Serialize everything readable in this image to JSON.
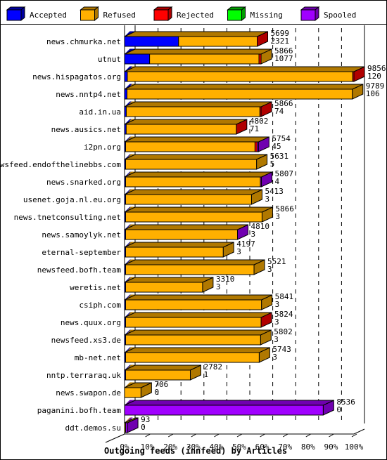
{
  "chart_data": {
    "type": "bar",
    "orientation": "horizontal",
    "stacked": true,
    "style": "3d",
    "title": "Outgoing feeds (innfeed) by Articles",
    "xlabel": "",
    "ylabel": "",
    "xlim": [
      0,
      100
    ],
    "x_unit": "% of max total",
    "max_total": 9856,
    "x_ticks": [
      "0%",
      "10%",
      "20%",
      "30%",
      "40%",
      "50%",
      "60%",
      "70%",
      "80%",
      "90%",
      "100%"
    ],
    "grid": "vertical dashed",
    "legend_position": "top",
    "legend": [
      {
        "name": "Accepted",
        "color": "#0000ff",
        "side": "#0000a0"
      },
      {
        "name": "Refused",
        "color": "#ffb000",
        "side": "#b07800"
      },
      {
        "name": "Rejected",
        "color": "#ff0000",
        "side": "#b00000"
      },
      {
        "name": "Missing",
        "color": "#00ff00",
        "side": "#00a000"
      },
      {
        "name": "Spooled",
        "color": "#a000ff",
        "side": "#7000b0"
      }
    ],
    "categories": [
      "news.chmurka.net",
      "utnut",
      "news.hispagatos.org",
      "news.nntp4.net",
      "aid.in.ua",
      "news.ausics.net",
      "i2pn.org",
      "newsfeed.endofthelinebbs.com",
      "news.snarked.org",
      "usenet.goja.nl.eu.org",
      "news.tnetconsulting.net",
      "news.samoylyk.net",
      "eternal-september",
      "newsfeed.bofh.team",
      "weretis.net",
      "csiph.com",
      "news.quux.org",
      "newsfeed.xs3.de",
      "mb-net.net",
      "nntp.terraraq.uk",
      "news.swapon.de",
      "paganini.bofh.team",
      "ddt.demos.su"
    ],
    "totals": [
      5699,
      5866,
      9856,
      9789,
      5866,
      4802,
      5754,
      5631,
      5807,
      5413,
      5866,
      4810,
      4197,
      5521,
      3310,
      5841,
      5824,
      5802,
      5743,
      2782,
      706,
      8536,
      93
    ],
    "accepted": [
      2321,
      1077,
      120,
      106,
      74,
      71,
      45,
      5,
      4,
      3,
      3,
      3,
      3,
      3,
      3,
      3,
      3,
      3,
      3,
      1,
      0,
      0,
      0
    ],
    "series": [
      {
        "name": "Accepted",
        "values": [
          2321,
          1077,
          120,
          106,
          74,
          71,
          45,
          5,
          4,
          3,
          3,
          3,
          3,
          3,
          3,
          3,
          3,
          3,
          3,
          1,
          0,
          0,
          0
        ]
      },
      {
        "name": "Refused",
        "values": [
          3378,
          4700,
          9686,
          9683,
          5742,
          4731,
          5560,
          5626,
          5790,
          5410,
          5863,
          4807,
          4194,
          5518,
          3307,
          5838,
          5821,
          5799,
          5740,
          2781,
          706,
          0,
          15
        ]
      },
      {
        "name": "Rejected",
        "values": [
          0,
          89,
          50,
          0,
          50,
          0,
          90,
          0,
          0,
          0,
          0,
          0,
          0,
          0,
          0,
          0,
          0,
          0,
          0,
          0,
          0,
          0,
          0
        ]
      },
      {
        "name": "Missing",
        "values": [
          0,
          0,
          0,
          0,
          0,
          0,
          0,
          0,
          0,
          0,
          0,
          0,
          0,
          0,
          0,
          0,
          0,
          0,
          0,
          0,
          0,
          0,
          0
        ]
      },
      {
        "name": "Spooled",
        "values": [
          0,
          0,
          0,
          0,
          0,
          0,
          59,
          0,
          13,
          0,
          0,
          0,
          0,
          0,
          0,
          0,
          0,
          0,
          0,
          0,
          0,
          8536,
          78
        ]
      }
    ],
    "end_cap_series": [
      "Rejected",
      "Refused",
      "Rejected",
      "Refused",
      "Rejected",
      "Rejected",
      "Spooled",
      "Refused",
      "Spooled",
      "Refused",
      "Refused",
      "Spooled",
      "Refused",
      "Refused",
      "Refused",
      "Refused",
      "Rejected",
      "Refused",
      "Refused",
      "Refused",
      "Refused",
      "Spooled",
      "Spooled"
    ]
  }
}
